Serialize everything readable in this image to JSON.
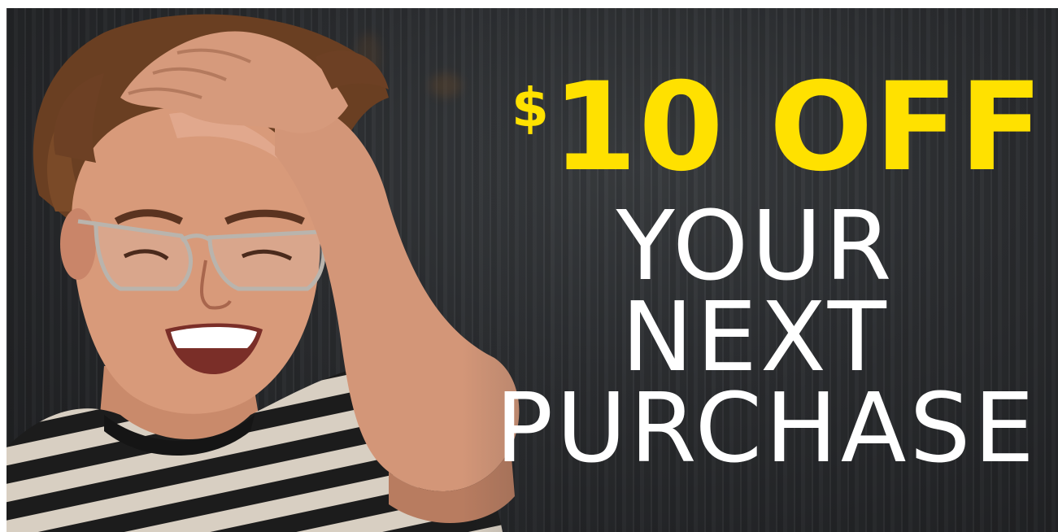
{
  "banner": {
    "currency_symbol": "$",
    "amount_off": "10 OFF",
    "line_2": "YOUR",
    "line_3": "NEXT",
    "line_4": "PURCHASE",
    "colors": {
      "accent": "#ffe100",
      "text": "#ffffff",
      "background": "#2b2d30"
    },
    "image": "smiling-man-with-glasses-photo"
  }
}
